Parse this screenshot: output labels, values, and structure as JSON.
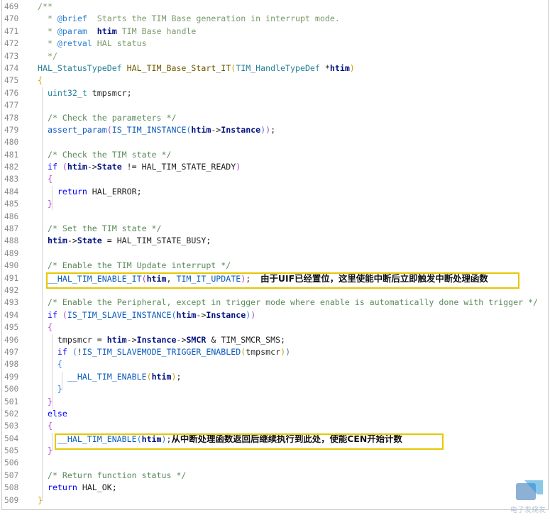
{
  "editor": {
    "lines": [
      {
        "n": "469",
        "t": [
          [
            "c-doc",
            "/**"
          ]
        ]
      },
      {
        "n": "470",
        "t": [
          [
            "c-doc",
            "  * "
          ],
          [
            "c-tag",
            "@brief"
          ],
          [
            "c-doc",
            "  Starts the TIM Base generation in interrupt mode."
          ]
        ]
      },
      {
        "n": "471",
        "t": [
          [
            "c-doc",
            "  * "
          ],
          [
            "c-tag",
            "@param"
          ],
          [
            "c-doc",
            "  "
          ],
          [
            "c-par",
            "htim"
          ],
          [
            "c-doc",
            " TIM Base handle"
          ]
        ]
      },
      {
        "n": "472",
        "t": [
          [
            "c-doc",
            "  * "
          ],
          [
            "c-tag",
            "@retval"
          ],
          [
            "c-doc",
            " HAL status"
          ]
        ]
      },
      {
        "n": "473",
        "t": [
          [
            "c-doc",
            "  */"
          ]
        ]
      },
      {
        "n": "474",
        "t": [
          [
            "c-type",
            "HAL_StatusTypeDef"
          ],
          [
            "c-txt",
            " "
          ],
          [
            "c-fn",
            "HAL_TIM_Base_Start_IT"
          ],
          [
            "c-br1",
            "("
          ],
          [
            "c-type",
            "TIM_HandleTypeDef"
          ],
          [
            "c-txt",
            " *"
          ],
          [
            "c-par",
            "htim"
          ],
          [
            "c-br1",
            ")"
          ]
        ]
      },
      {
        "n": "475",
        "t": [
          [
            "c-br1",
            "{"
          ]
        ]
      },
      {
        "n": "476",
        "t": [
          [
            "c-txt",
            "  "
          ],
          [
            "c-type",
            "uint32_t"
          ],
          [
            "c-txt",
            " tmpsmcr;"
          ]
        ]
      },
      {
        "n": "477",
        "t": []
      },
      {
        "n": "478",
        "t": [
          [
            "c-txt",
            "  "
          ],
          [
            "c-com",
            "/* Check the parameters */"
          ]
        ]
      },
      {
        "n": "479",
        "t": [
          [
            "c-txt",
            "  "
          ],
          [
            "c-mac",
            "assert_param"
          ],
          [
            "c-br2",
            "("
          ],
          [
            "c-mac",
            "IS_TIM_INSTANCE"
          ],
          [
            "c-br3",
            "("
          ],
          [
            "c-par",
            "htim"
          ],
          [
            "c-txt",
            "->"
          ],
          [
            "c-par",
            "Instance"
          ],
          [
            "c-br3",
            ")"
          ],
          [
            "c-br2",
            ")"
          ],
          [
            "c-txt",
            ";"
          ]
        ]
      },
      {
        "n": "480",
        "t": []
      },
      {
        "n": "481",
        "t": [
          [
            "c-txt",
            "  "
          ],
          [
            "c-com",
            "/* Check the TIM state */"
          ]
        ]
      },
      {
        "n": "482",
        "t": [
          [
            "c-txt",
            "  "
          ],
          [
            "c-kw",
            "if"
          ],
          [
            "c-txt",
            " "
          ],
          [
            "c-br2",
            "("
          ],
          [
            "c-par",
            "htim"
          ],
          [
            "c-txt",
            "->"
          ],
          [
            "c-par",
            "State"
          ],
          [
            "c-txt",
            " != HAL_TIM_STATE_READY"
          ],
          [
            "c-br2",
            ")"
          ]
        ]
      },
      {
        "n": "483",
        "t": [
          [
            "c-txt",
            "  "
          ],
          [
            "c-br2",
            "{"
          ]
        ]
      },
      {
        "n": "484",
        "t": [
          [
            "c-txt",
            "    "
          ],
          [
            "c-kw",
            "return"
          ],
          [
            "c-txt",
            " HAL_ERROR;"
          ]
        ]
      },
      {
        "n": "485",
        "t": [
          [
            "c-txt",
            "  "
          ],
          [
            "c-br2",
            "}"
          ]
        ]
      },
      {
        "n": "486",
        "t": []
      },
      {
        "n": "487",
        "t": [
          [
            "c-txt",
            "  "
          ],
          [
            "c-com",
            "/* Set the TIM state */"
          ]
        ]
      },
      {
        "n": "488",
        "t": [
          [
            "c-txt",
            "  "
          ],
          [
            "c-par",
            "htim"
          ],
          [
            "c-txt",
            "->"
          ],
          [
            "c-par",
            "State"
          ],
          [
            "c-txt",
            " = HAL_TIM_STATE_BUSY;"
          ]
        ]
      },
      {
        "n": "489",
        "t": []
      },
      {
        "n": "490",
        "t": [
          [
            "c-txt",
            "  "
          ],
          [
            "c-com",
            "/* Enable the TIM Update interrupt */"
          ]
        ]
      },
      {
        "n": "491",
        "t": [
          [
            "c-txt",
            "  "
          ],
          [
            "c-mac",
            "__HAL_TIM_ENABLE_IT"
          ],
          [
            "c-br2",
            "("
          ],
          [
            "c-par",
            "htim"
          ],
          [
            "c-txt",
            ", "
          ],
          [
            "c-mac",
            "TIM_IT_UPDATE"
          ],
          [
            "c-br2",
            ")"
          ],
          [
            "c-txt",
            ";  "
          ],
          [
            "note",
            "由于UIF已经置位，这里使能中断后立即触发中断处理函数"
          ]
        ]
      },
      {
        "n": "492",
        "t": []
      },
      {
        "n": "493",
        "t": [
          [
            "c-txt",
            "  "
          ],
          [
            "c-com",
            "/* Enable the Peripheral, except in trigger mode where enable is automatically done with trigger */"
          ]
        ]
      },
      {
        "n": "494",
        "t": [
          [
            "c-txt",
            "  "
          ],
          [
            "c-kw",
            "if"
          ],
          [
            "c-txt",
            " "
          ],
          [
            "c-br2",
            "("
          ],
          [
            "c-mac",
            "IS_TIM_SLAVE_INSTANCE"
          ],
          [
            "c-br3",
            "("
          ],
          [
            "c-par",
            "htim"
          ],
          [
            "c-txt",
            "->"
          ],
          [
            "c-par",
            "Instance"
          ],
          [
            "c-br3",
            ")"
          ],
          [
            "c-br2",
            ")"
          ]
        ]
      },
      {
        "n": "495",
        "t": [
          [
            "c-txt",
            "  "
          ],
          [
            "c-br2",
            "{"
          ]
        ]
      },
      {
        "n": "496",
        "t": [
          [
            "c-txt",
            "    tmpsmcr = "
          ],
          [
            "c-par",
            "htim"
          ],
          [
            "c-txt",
            "->"
          ],
          [
            "c-par",
            "Instance"
          ],
          [
            "c-txt",
            "->"
          ],
          [
            "c-par",
            "SMCR"
          ],
          [
            "c-txt",
            " & TIM_SMCR_SMS;"
          ]
        ]
      },
      {
        "n": "497",
        "t": [
          [
            "c-txt",
            "    "
          ],
          [
            "c-kw",
            "if"
          ],
          [
            "c-txt",
            " "
          ],
          [
            "c-br3",
            "("
          ],
          [
            "c-txt",
            "!"
          ],
          [
            "c-mac",
            "IS_TIM_SLAVEMODE_TRIGGER_ENABLED"
          ],
          [
            "c-br1",
            "("
          ],
          [
            "c-txt",
            "tmpsmcr"
          ],
          [
            "c-br1",
            ")"
          ],
          [
            "c-br3",
            ")"
          ]
        ]
      },
      {
        "n": "498",
        "t": [
          [
            "c-txt",
            "    "
          ],
          [
            "c-br3",
            "{"
          ]
        ]
      },
      {
        "n": "499",
        "t": [
          [
            "c-txt",
            "      "
          ],
          [
            "c-mac",
            "__HAL_TIM_ENABLE"
          ],
          [
            "c-br1",
            "("
          ],
          [
            "c-par",
            "htim"
          ],
          [
            "c-br1",
            ")"
          ],
          [
            "c-txt",
            ";"
          ]
        ]
      },
      {
        "n": "500",
        "t": [
          [
            "c-txt",
            "    "
          ],
          [
            "c-br3",
            "}"
          ]
        ]
      },
      {
        "n": "501",
        "t": [
          [
            "c-txt",
            "  "
          ],
          [
            "c-br2",
            "}"
          ]
        ]
      },
      {
        "n": "502",
        "t": [
          [
            "c-txt",
            "  "
          ],
          [
            "c-kw",
            "else"
          ]
        ]
      },
      {
        "n": "503",
        "t": [
          [
            "c-txt",
            "  "
          ],
          [
            "c-br2",
            "{"
          ]
        ]
      },
      {
        "n": "504",
        "t": [
          [
            "c-txt",
            "    "
          ],
          [
            "c-mac",
            "__HAL_TIM_ENABLE"
          ],
          [
            "c-br3",
            "("
          ],
          [
            "c-par",
            "htim"
          ],
          [
            "c-br3",
            ")"
          ],
          [
            "c-txt",
            ";"
          ],
          [
            "note",
            "从中断处理函数返回后继续执行到此处，使能CEN开始计数"
          ]
        ]
      },
      {
        "n": "505",
        "t": [
          [
            "c-txt",
            "  "
          ],
          [
            "c-br2",
            "}"
          ]
        ]
      },
      {
        "n": "506",
        "t": []
      },
      {
        "n": "507",
        "t": [
          [
            "c-txt",
            "  "
          ],
          [
            "c-com",
            "/* Return function status */"
          ]
        ]
      },
      {
        "n": "508",
        "t": [
          [
            "c-txt",
            "  "
          ],
          [
            "c-kw",
            "return"
          ],
          [
            "c-txt",
            " HAL_OK;"
          ]
        ]
      },
      {
        "n": "509",
        "t": [
          [
            "c-br1",
            "}"
          ]
        ]
      }
    ]
  },
  "annotations": {
    "note_491": "由于UIF已经置位，这里使能中断后立即触发中断处理函数",
    "note_504": "从中断处理函数返回后继续执行到此处，使能CEN开始计数"
  },
  "watermark": {
    "text": "电子发烧友",
    "icon": "brand-logo-icon"
  },
  "colors": {
    "comment": "#5a8a5a",
    "keyword": "#0000ff",
    "highlight_border": "#e6c800",
    "line_number": "#8a8a8a"
  }
}
